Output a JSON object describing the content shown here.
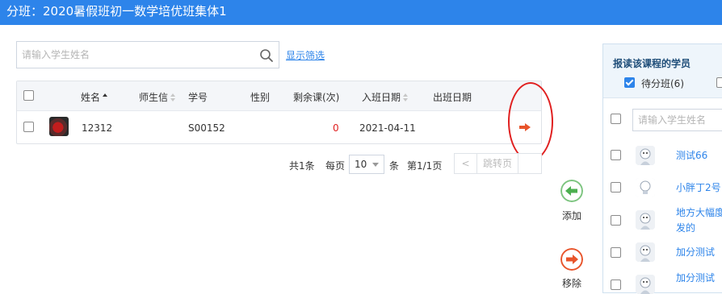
{
  "header": {
    "title": "分班：2020暑假班初一数学培优班集体1"
  },
  "search": {
    "placeholder": "请输入学生姓名",
    "filter_link": "显示筛选"
  },
  "table": {
    "columns": [
      "姓名",
      "师生信",
      "学号",
      "性别",
      "剩余课(次)",
      "入班日期",
      "出班日期"
    ],
    "rows": [
      {
        "name": "12312",
        "teacher_letter": "",
        "student_no": "S00152",
        "gender": "",
        "remaining": "0",
        "enroll_date": "2021-04-11",
        "leave_date": ""
      }
    ]
  },
  "pager": {
    "total": "共1条",
    "per_page_label": "每页",
    "per_page_value": "10",
    "unit": "条",
    "page_info": "第1/1页",
    "prev": "<",
    "jump": "跳转页"
  },
  "actions": {
    "add_label": "添加",
    "remove_label": "移除"
  },
  "panel": {
    "title": "报读该课程的学员",
    "filter_pending": "待分班(6)",
    "search_placeholder": "请输入学生姓名",
    "students": [
      {
        "name": "测试66"
      },
      {
        "name": "小胖丁2号"
      },
      {
        "name": "地方大幅度发的"
      },
      {
        "name": "加分测试"
      },
      {
        "name": "加分测试"
      }
    ]
  },
  "colors": {
    "brand": "#2d84ea",
    "danger": "#e02020",
    "add": "#4caf50",
    "remove": "#e8542b",
    "remaining_zero": "#e02020"
  }
}
